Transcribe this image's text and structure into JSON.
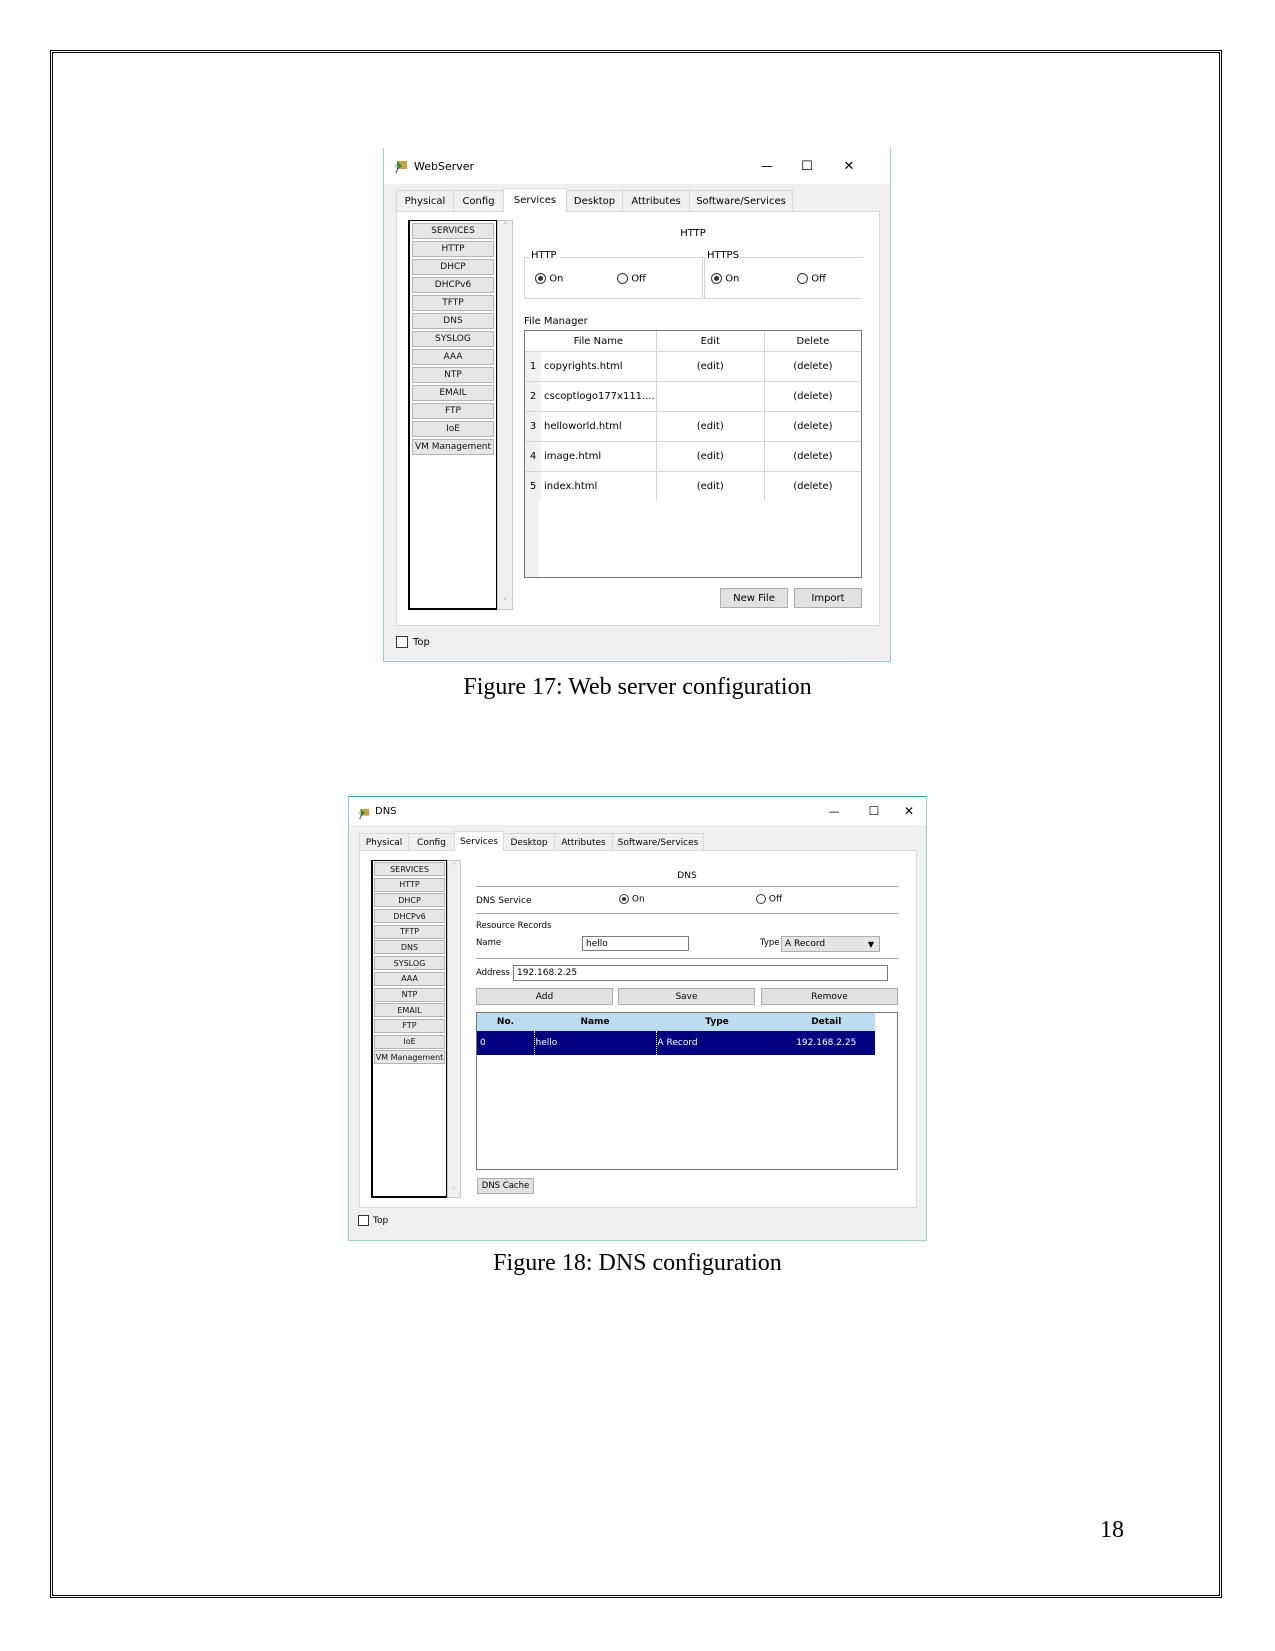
{
  "page_number": "18",
  "figures": [
    {
      "caption": "Figure 17: Web server configuration",
      "window": {
        "title": "WebServer",
        "controls": {
          "minimize": "—",
          "maximize": "☐",
          "close": "✕"
        },
        "tabs": [
          "Physical",
          "Config",
          "Services",
          "Desktop",
          "Attributes",
          "Software/Services"
        ],
        "active_tab": "Services",
        "services": [
          "SERVICES",
          "HTTP",
          "DHCP",
          "DHCPv6",
          "TFTP",
          "DNS",
          "SYSLOG",
          "AAA",
          "NTP",
          "EMAIL",
          "FTP",
          "IoE",
          "VM Management"
        ],
        "panel_title": "HTTP",
        "http_group": {
          "label": "HTTP",
          "on_label": "On",
          "off_label": "Off",
          "selected": "On"
        },
        "https_group": {
          "label": "HTTPS",
          "on_label": "On",
          "off_label": "Off",
          "selected": "On"
        },
        "file_manager": {
          "label": "File Manager",
          "columns": [
            "File Name",
            "Edit",
            "Delete"
          ],
          "rows": [
            {
              "no": "1",
              "name": "copyrights.html",
              "edit": "(edit)",
              "delete": "(delete)"
            },
            {
              "no": "2",
              "name": "cscoptlogo177x111....",
              "edit": "",
              "delete": "(delete)"
            },
            {
              "no": "3",
              "name": "helloworld.html",
              "edit": "(edit)",
              "delete": "(delete)"
            },
            {
              "no": "4",
              "name": "image.html",
              "edit": "(edit)",
              "delete": "(delete)"
            },
            {
              "no": "5",
              "name": "index.html",
              "edit": "(edit)",
              "delete": "(delete)"
            }
          ]
        },
        "buttons": {
          "new_file": "New File",
          "import": "Import"
        },
        "top_checkbox": {
          "label": "Top",
          "checked": false
        }
      }
    },
    {
      "caption": "Figure 18: DNS configuration",
      "window": {
        "title": "DNS",
        "controls": {
          "minimize": "—",
          "maximize": "☐",
          "close": "✕"
        },
        "tabs": [
          "Physical",
          "Config",
          "Services",
          "Desktop",
          "Attributes",
          "Software/Services"
        ],
        "active_tab": "Services",
        "services": [
          "SERVICES",
          "HTTP",
          "DHCP",
          "DHCPv6",
          "TFTP",
          "DNS",
          "SYSLOG",
          "AAA",
          "NTP",
          "EMAIL",
          "FTP",
          "IoE",
          "VM Management"
        ],
        "panel_title": "DNS",
        "dns_service": {
          "label": "DNS Service",
          "on_label": "On",
          "off_label": "Off",
          "selected": "On"
        },
        "resource_records_label": "Resource Records",
        "name_label": "Name",
        "name_value": "hello",
        "type_label": "Type",
        "type_value": "A Record",
        "address_label": "Address",
        "address_value": "192.168.2.25",
        "buttons": {
          "add": "Add",
          "save": "Save",
          "remove": "Remove",
          "dns_cache": "DNS Cache"
        },
        "table": {
          "columns": [
            "No.",
            "Name",
            "Type",
            "Detail"
          ],
          "rows": [
            {
              "no": "0",
              "name": "hello",
              "type": "A Record",
              "detail": "192.168.2.25"
            }
          ]
        },
        "top_checkbox": {
          "label": "Top",
          "checked": false
        }
      }
    }
  ]
}
